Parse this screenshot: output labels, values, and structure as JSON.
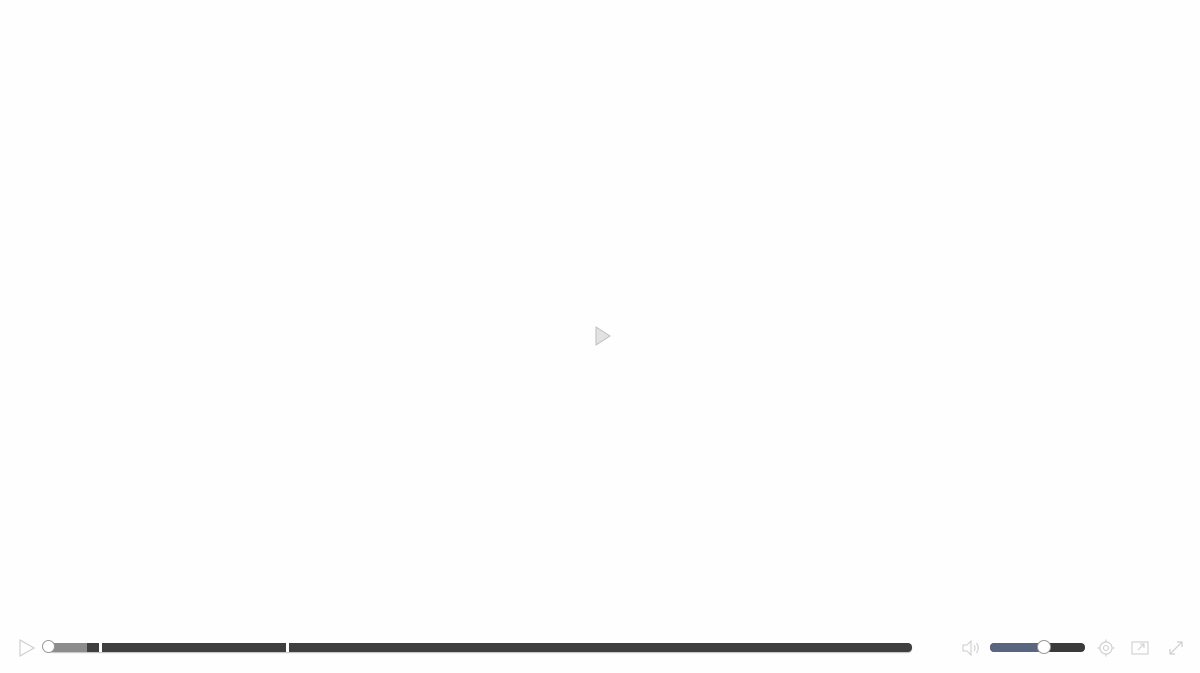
{
  "player": {
    "center_play_icon": "play-icon",
    "controls": {
      "play_icon": "play-icon",
      "progress": {
        "current_fraction": 0.0,
        "buffered_fraction": 0.045,
        "chapter_marker_fractions": [
          0.06,
          0.277
        ]
      },
      "volume": {
        "icon": "volume-icon",
        "level_fraction": 0.57
      },
      "settings_icon": "gear-icon",
      "pip_icon": "picture-in-picture-icon",
      "fullscreen_icon": "fullscreen-icon"
    }
  },
  "colors": {
    "track": "#3f3f3f",
    "buffered": "#8c8c8c",
    "volume_fill": "#5a6580",
    "icon_stroke": "#cfcfcf"
  }
}
